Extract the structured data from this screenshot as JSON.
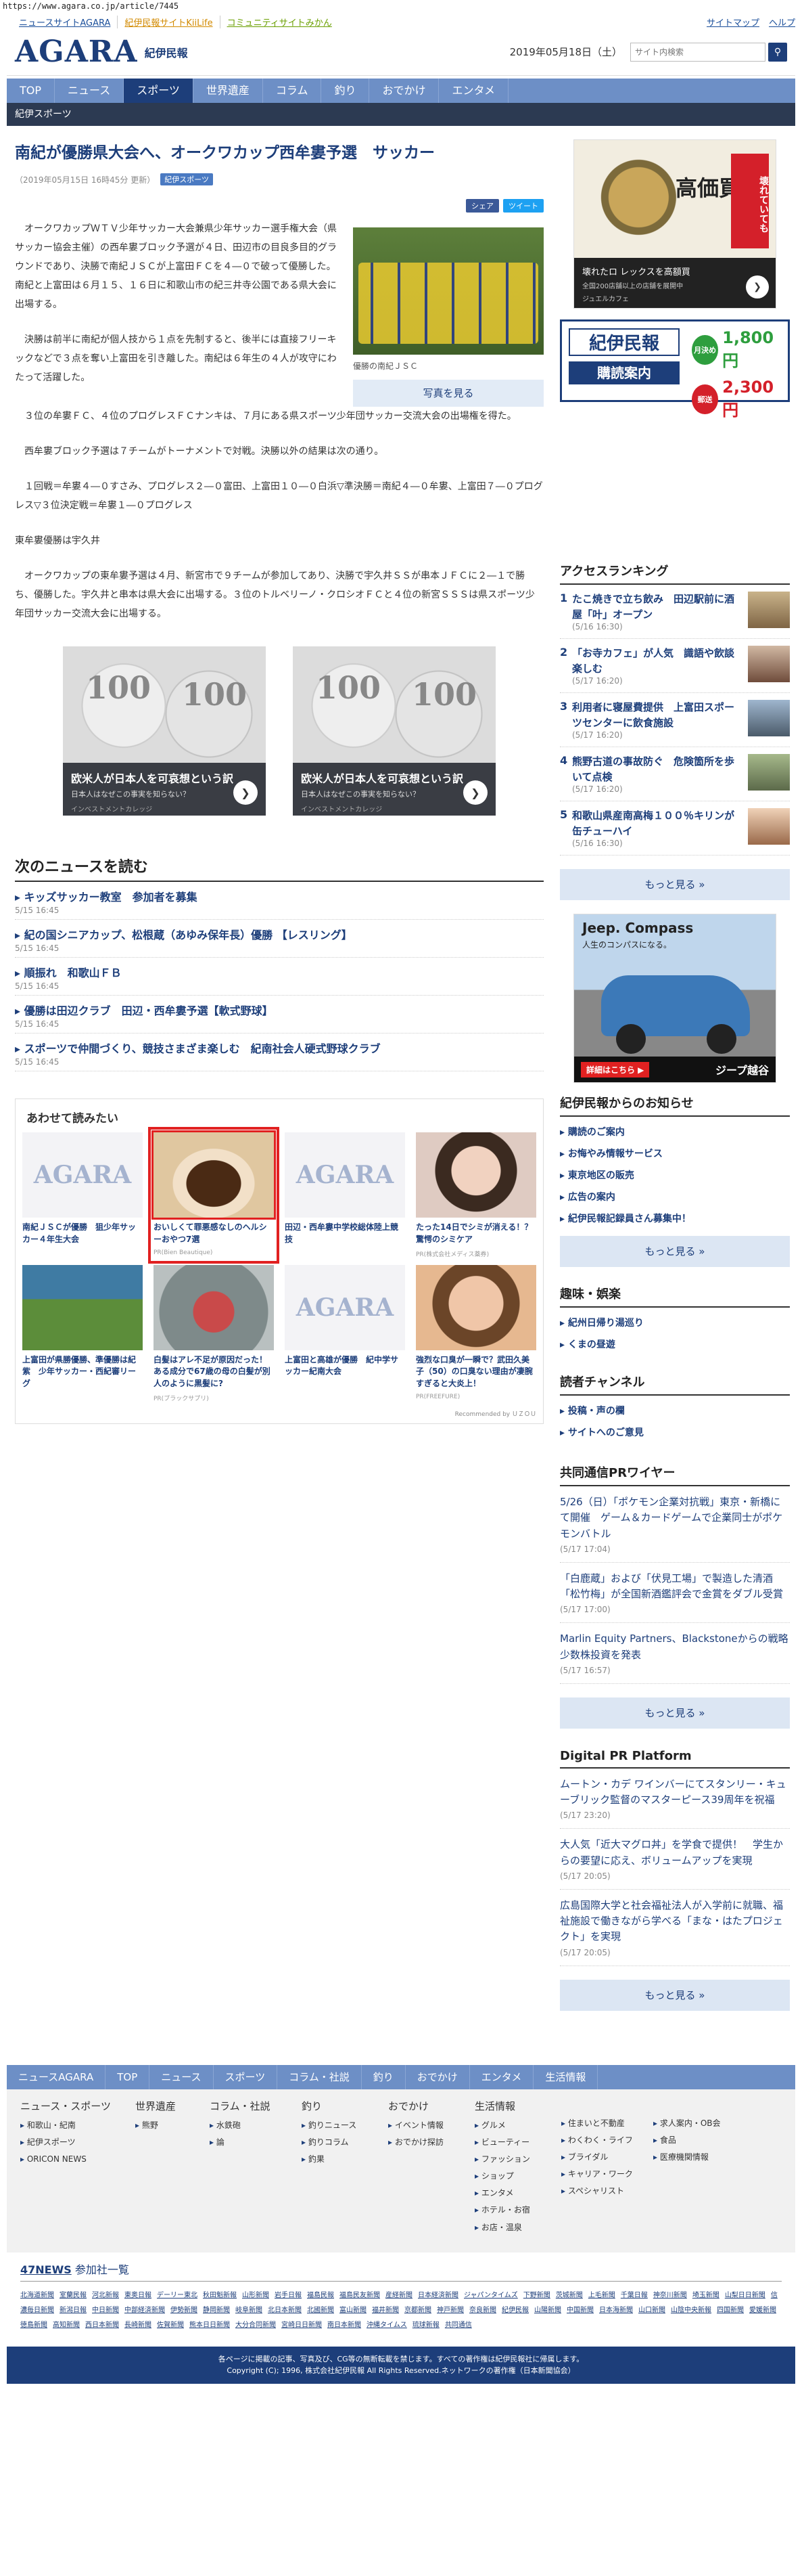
{
  "url": "https://www.agara.co.jp/article/7445",
  "toplinks": {
    "left": [
      "ニュースサイトAGARA",
      "紀伊民報サイトKiiLife",
      "コミュニティサイトみかん"
    ],
    "right": [
      "サイトマップ",
      "ヘルプ"
    ]
  },
  "header": {
    "logo": "AGARA",
    "logo_sub": "紀伊民報",
    "date": "2019年05月18日（土）",
    "search_placeholder": "サイト内検索"
  },
  "gnav": [
    "TOP",
    "ニュース",
    "スポーツ",
    "世界遺産",
    "コラム",
    "釣り",
    "おでかけ",
    "エンタメ"
  ],
  "subnav": "紀伊スポーツ",
  "article": {
    "title": "南紀が優勝県大会へ、オークワカップ西牟婁予選　サッカー",
    "meta": "（2019年05月15日 16時45分 更新）",
    "tag": "紀伊スポーツ",
    "share_fb": "シェア",
    "share_tw": "ツイート",
    "paragraphs_side": [
      "オークワカップＷＴＶ少年サッカー大会兼県少年サッカー選手権大会（県サッカー協会主催）の西牟婁ブロック予選が４日、田辺市の目良多目的グラウンドであり、決勝で南紀ＪＳＣが上富田ＦＣを４―０で破って優勝した。南紀と上富田は６月１５、１６日に和歌山市の紀三井寺公園である県大会に出場する。",
      "決勝は前半に南紀が個人技から１点を先制すると、後半には直接フリーキックなどで３点を奪い上富田を引き離した。南紀は６年生の４人が攻守にわたって活躍した。"
    ],
    "paragraphs_full": [
      "３位の牟婁ＦＣ、４位のプログレスＦＣナンキは、７月にある県スポーツ少年団サッカー交流大会の出場権を得た。",
      "西牟婁ブロック予選は７チームがトーナメントで対戦。決勝以外の結果は次の通り。",
      "１回戦＝牟婁４―０すさみ、プログレス２―０富田、上富田１０―０白浜▽準決勝＝南紀４―０牟婁、上富田７―０プログレス▽３位決定戦＝牟婁１―０プログレス",
      "東牟婁優勝は宇久井",
      "オークワカップの東牟婁予選は４月、新宮市で９チームが参加してあり、決勝で宇久井ＳＳが串本ＪＦＣに２―１で勝ち、優勝した。宇久井と串本は県大会に出場する。３位のトルベリーノ・クロシオＦＣと４位の新宮ＳＳＳは県スポーツ少年団サッカー交流大会に出場する。"
    ],
    "photo_caption": "優勝の南紀ＪＳＣ",
    "photo_button": "写真を見る"
  },
  "content_ads": [
    {
      "title": "欧米人が日本人を可哀想という訳",
      "sub": "日本人はなぜこの事実を知らない？",
      "adv": "インベストメントカレッジ",
      "coin": "100"
    },
    {
      "title": "欧米人が日本人を可哀想という訳",
      "sub": "日本人はなぜこの事実を知らない？",
      "adv": "インベストメントカレッジ",
      "coin": "100"
    }
  ],
  "next_news": {
    "heading": "次のニュースを読む",
    "items": [
      {
        "title": "キッズサッカー教室　参加者を募集",
        "date": "5/15 16:45"
      },
      {
        "title": "紀の国シニアカップ、松根蔵（あゆみ保年長）優勝 【レスリング】",
        "date": "5/15 16:45"
      },
      {
        "title": "順振れ　和歌山ＦＢ",
        "date": "5/15 16:45"
      },
      {
        "title": "優勝は田辺クラブ　田辺・西牟婁予選【軟式野球】",
        "date": "5/15 16:45"
      },
      {
        "title": "スポーツで仲間づくり、競技さまざま楽しむ　紀南社会人硬式野球クラブ",
        "date": "5/15 16:45"
      }
    ]
  },
  "recommend": {
    "heading": "あわせて読みたい",
    "cards": [
      {
        "title": "南紀ＪＳＣが優勝　狙少年サッカー４年生大会",
        "pr": "",
        "img": "ag"
      },
      {
        "title": "おいしくて罪悪感なしのヘルシーおやつ7選",
        "pr": "PR(Bien Beautique)",
        "img": "cake"
      },
      {
        "title": "田辺・西牟婁中学校総体陸上競技",
        "pr": "",
        "img": "ag"
      },
      {
        "title": "たった14日でシミが消える！？驚愕のシミケア",
        "pr": "PR(株式会社メディス薬券)",
        "img": "face1"
      },
      {
        "title": "上富田が県勝優勝、準優勝は紀紫　少年サッカー・西紀審リーグ",
        "pr": "",
        "img": "field"
      },
      {
        "title": "白髪はアレ不足が原因だった！ある成分で67歳の母の白髪が別人のように黒髪に?",
        "pr": "PR(ブラックサプリ)",
        "img": "hair"
      },
      {
        "title": "上富田と高雄が優勝　紀中学サッカー紀南大会",
        "pr": "",
        "img": "ag"
      },
      {
        "title": "強烈な口臭が一瞬で？武田久美子（50）の口臭ない理由が凄腕すぎると大炎上！",
        "pr": "PR(FREEFURE)",
        "img": "face2"
      }
    ],
    "footer": "Recommended by ＵＺＯＵ"
  },
  "side_ad1": {
    "vertical": "壊れていても",
    "big": "高価買取",
    "line1": "壊れたロ レックスを高額買",
    "line2": "全国200店舗以上の店舗を展開中",
    "line3": "ジュエルカフェ",
    "brand": "JEWEL CAFE"
  },
  "side_ad2": {
    "name": "紀伊民報",
    "apply": "購読案内",
    "mon_label": "月決め",
    "mon_price": "1,800円",
    "mail_label": "郵送",
    "mail_price": "2,300円"
  },
  "ranking": {
    "heading": "アクセスランキング",
    "items": [
      {
        "n": "1",
        "title": "たこ焼きで立ち飲み　田辺駅前に酒屋「叶」オープン",
        "date": "(5/16 16:30)"
      },
      {
        "n": "2",
        "title": "「お寺カフェ」が人気　識語や飲談楽しむ",
        "date": "(5/17 16:20)"
      },
      {
        "n": "3",
        "title": "利用者に寝屋費提供　上富田スポーツセンターに飲食施設",
        "date": "(5/17 16:20)"
      },
      {
        "n": "4",
        "title": "熊野古道の事故防ぐ　危険箇所を歩いて点検",
        "date": "(5/17 16:20)"
      },
      {
        "n": "5",
        "title": "和歌山県産南高梅１００％キリンが缶チューハイ",
        "date": "(5/16 16:30)"
      }
    ],
    "more": "もっと見る »"
  },
  "jeep_ad": {
    "title": "Jeep. Compass",
    "sub": "人生のコンパスになる。",
    "detail": "詳細はこちら ▶",
    "brand": "ジープ越谷"
  },
  "notice": {
    "heading": "紀伊民報からのお知らせ",
    "items": [
      "購読のご案内",
      "お悔やみ情報サービス",
      "東京地区の販売",
      "広告の案内",
      "紀伊民報記録員さん募集中！"
    ],
    "more": "もっと見る »"
  },
  "hobby": {
    "heading": "趣味・娯楽",
    "items": [
      "紀州日帰り湯巡り",
      "くまの昼遊"
    ]
  },
  "reader": {
    "heading": "読者チャンネル",
    "items": [
      "投稿・声の欄",
      "サイトへのご意見"
    ]
  },
  "kyodo": {
    "heading": "共同通信PRワイヤー",
    "items": [
      {
        "title": "5/26（日）「ポケモン企業対抗戦」東京・新橋にて開催　ゲーム＆カードゲームで企業同士がポケモンバトル",
        "date": "(5/17 17:04)"
      },
      {
        "title": "「白鹿蔵」および「伏見工場」で製造した清酒「松竹梅」が全国新酒鑑評会で金賞をダブル受賞",
        "date": "(5/17 17:00)"
      },
      {
        "title": "Marlin Equity Partners、Blackstoneからの戦略少数株投資を発表",
        "date": "(5/17 16:57)"
      }
    ],
    "more": "もっと見る »"
  },
  "digital": {
    "heading": "Digital PR Platform",
    "items": [
      {
        "title": "ムートン・カデ ワインバーにてスタンリー・キューブリック監督のマスターピース39周年を祝福",
        "date": "(5/17 23:20)"
      },
      {
        "title": "大人気「近大マグロ丼」を学食で提供！　学生からの要望に応え、ボリュームアップを実現",
        "date": "(5/17 20:05)"
      },
      {
        "title": "広島国際大学と社会福祉法人が入学前に就職、福祉施設で働きながら学べる「まな・はたプロジェクト」を実現",
        "date": "(5/17 20:05)"
      }
    ],
    "more": "もっと見る »"
  },
  "footer_nav": [
    "ニュースAGARA",
    "TOP",
    "ニュース",
    "スポーツ",
    "コラム・社説",
    "釣り",
    "おでかけ",
    "エンタメ",
    "生活情報"
  ],
  "footer_cols": [
    {
      "h": "ニュース・スポーツ",
      "items": [
        "和歌山・紀南",
        "紀伊スポーツ",
        "ORICON NEWS"
      ]
    },
    {
      "h": "世界遺産",
      "items": [
        "熊野"
      ]
    },
    {
      "h": "コラム・社説",
      "items": [
        "水鉄砲",
        "論"
      ]
    },
    {
      "h": "釣り",
      "items": [
        "釣りニュース",
        "釣りコラム",
        "釣果"
      ]
    },
    {
      "h": "おでかけ",
      "items": [
        "イベント情報",
        "おでかけ探訪"
      ]
    },
    {
      "h": "生活情報",
      "items": [
        "グルメ",
        "ビューティー",
        "ファッション",
        "ショップ",
        "エンタメ",
        "ホテル・お宿",
        "お店・温泉"
      ]
    },
    {
      "h": "",
      "items": [
        "住まいと不動産",
        "わくわく・ライフ",
        "ブライダル",
        "キャリア・ワーク",
        "スペシャリスト"
      ]
    },
    {
      "h": "",
      "items": [
        "求人案内・OB会",
        "食品",
        "医療機関情報"
      ]
    }
  ],
  "f47": {
    "brand": "47NEWS",
    "label": "参加社一覧"
  },
  "papers": [
    "北海道新聞",
    "室蘭民報",
    "河北新報",
    "東奥日報",
    "デーリー東北",
    "秋田魁新報",
    "山形新聞",
    "岩手日報",
    "福島民報",
    "福島民友新聞",
    "産経新聞",
    "日本経済新聞",
    "ジャパンタイムズ",
    "下野新聞",
    "茨城新聞",
    "上毛新聞",
    "千葉日報",
    "神奈川新聞",
    "埼玉新聞",
    "山梨日日新聞",
    "信濃毎日新聞",
    "新潟日報",
    "中日新聞",
    "中部経済新聞",
    "伊勢新聞",
    "静岡新聞",
    "岐阜新聞",
    "北日本新聞",
    "北國新聞",
    "富山新聞",
    "福井新聞",
    "京都新聞",
    "神戸新聞",
    "奈良新聞",
    "紀伊民報",
    "山陽新聞",
    "中国新聞",
    "日本海新聞",
    "山口新聞",
    "山陰中央新報",
    "四国新聞",
    "愛媛新聞",
    "徳島新聞",
    "高知新聞",
    "西日本新聞",
    "長崎新聞",
    "佐賀新聞",
    "熊本日日新聞",
    "大分合同新聞",
    "宮崎日日新聞",
    "南日本新聞",
    "沖縄タイムス",
    "琉球新報",
    "共同通信"
  ],
  "copyright": [
    "各ページに掲載の記事、写真及び、CG等の無断転載を禁じます。すべての著作権は紀伊民報社に帰属します。",
    "Copyright (C); 1996, 株式会社紀伊民報 All Rights Reserved.ネットワークの著作権（日本新聞協会）"
  ]
}
